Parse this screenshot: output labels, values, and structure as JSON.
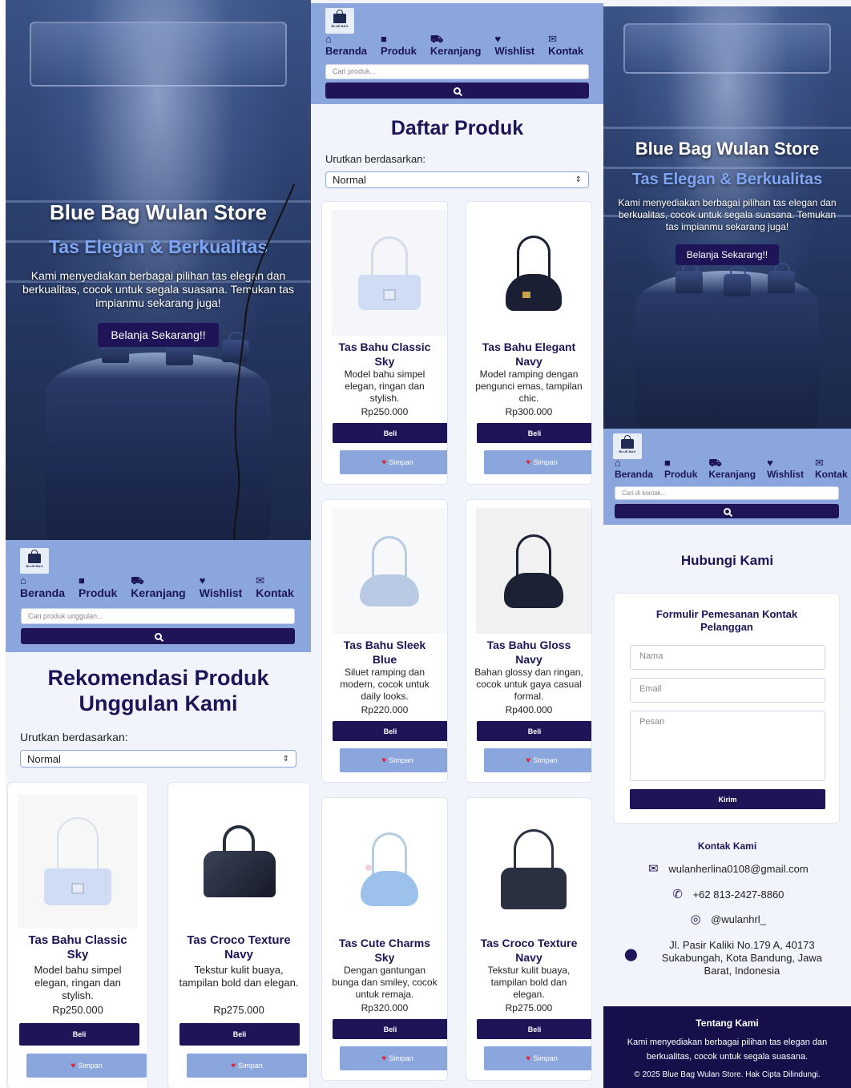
{
  "brand": {
    "name": "Blue Bag Wulan Store",
    "tagline": "Tas Elegan & Berkualitas",
    "description": "Kami menyediakan berbagai pilihan tas elegan dan berkualitas, cocok untuk segala suasana. Temukan tas impianmu sekarang juga!",
    "cta": "Belanja Sekarang!!",
    "logo_text": "BLUE BAG"
  },
  "nav": {
    "items": [
      {
        "label": "Beranda",
        "icon": "home-icon"
      },
      {
        "label": "Produk",
        "icon": "bag-icon"
      },
      {
        "label": "Keranjang",
        "icon": "cart-icon"
      },
      {
        "label": "Wishlist",
        "icon": "heart-icon"
      },
      {
        "label": "Kontak",
        "icon": "mail-icon"
      }
    ]
  },
  "home": {
    "search_placeholder": "Cari produk unggulan...",
    "section_title": "Rekomendasi Produk Unggulan Kami",
    "sort_label": "Urutkan berdasarkan:",
    "sort_value": "Normal",
    "products": [
      {
        "name": "Tas Bahu Classic Sky",
        "desc": "Model bahu simpel elegan, ringan dan stylish.",
        "price": "Rp250.000",
        "buy": "Beli",
        "save": "Simpan"
      },
      {
        "name": "Tas Croco Texture Navy",
        "desc": "Tekstur kulit buaya, tampilan bold dan elegan.",
        "price": "Rp275.000",
        "buy": "Beli",
        "save": "Simpan"
      }
    ]
  },
  "catalog": {
    "search_placeholder": "Cari produk...",
    "section_title": "Daftar Produk",
    "sort_label": "Urutkan berdasarkan:",
    "sort_value": "Normal",
    "products": [
      {
        "name": "Tas Bahu Classic Sky",
        "desc": "Model bahu simpel elegan, ringan dan stylish.",
        "price": "Rp250.000",
        "buy": "Beli",
        "save": "Simpan"
      },
      {
        "name": "Tas Bahu Elegant Navy",
        "desc": "Model ramping dengan pengunci emas, tampilan chic.",
        "price": "Rp300.000",
        "buy": "Beli",
        "save": "Simpan"
      },
      {
        "name": "Tas Bahu Sleek Blue",
        "desc": "Siluet ramping dan modern, cocok untuk daily looks.",
        "price": "Rp220.000",
        "buy": "Beli",
        "save": "Simpan"
      },
      {
        "name": "Tas Bahu Gloss Navy",
        "desc": "Bahan glossy dan ringan, cocok untuk gaya casual formal.",
        "price": "Rp400.000",
        "buy": "Beli",
        "save": "Simpan"
      },
      {
        "name": "Tas Cute Charms Sky",
        "desc": "Dengan gantungan bunga dan smiley, cocok untuk remaja.",
        "price": "Rp320.000",
        "buy": "Beli",
        "save": "Simpan"
      },
      {
        "name": "Tas Croco Texture Navy",
        "desc": "Tekstur kulit buaya, tampilan bold dan elegan.",
        "price": "Rp275.000",
        "buy": "Beli",
        "save": "Simpan"
      }
    ]
  },
  "contact": {
    "search_placeholder": "Cari di kontak...",
    "section_title": "Hubungi Kami",
    "form_title": "Formulir Pemesanan Kontak Pelanggan",
    "name_placeholder": "Nama",
    "email_placeholder": "Email",
    "message_placeholder": "Pesan",
    "submit": "Kirim",
    "info_title": "Kontak Kami",
    "email": "wulanherlina0108@gmail.com",
    "phone": "+62 813-2427-8860",
    "instagram": "@wulanhrl_",
    "address": "Jl. Pasir Kaliki No.179 A, 40173 Sukabungah, Kota Bandung, Jawa Barat, Indonesia"
  },
  "footer": {
    "title": "Tentang Kami",
    "text": "Kami menyediakan berbagai pilihan tas elegan dan berkualitas, cocok untuk segala suasana.",
    "copyright": "© 2025 Blue Bag Wulan Store. Hak Cipta Dilindungi."
  },
  "colors": {
    "primary": "#1f1458",
    "header": "#8aa6dc",
    "accent": "#7ea6f5",
    "footer": "#15104a"
  }
}
